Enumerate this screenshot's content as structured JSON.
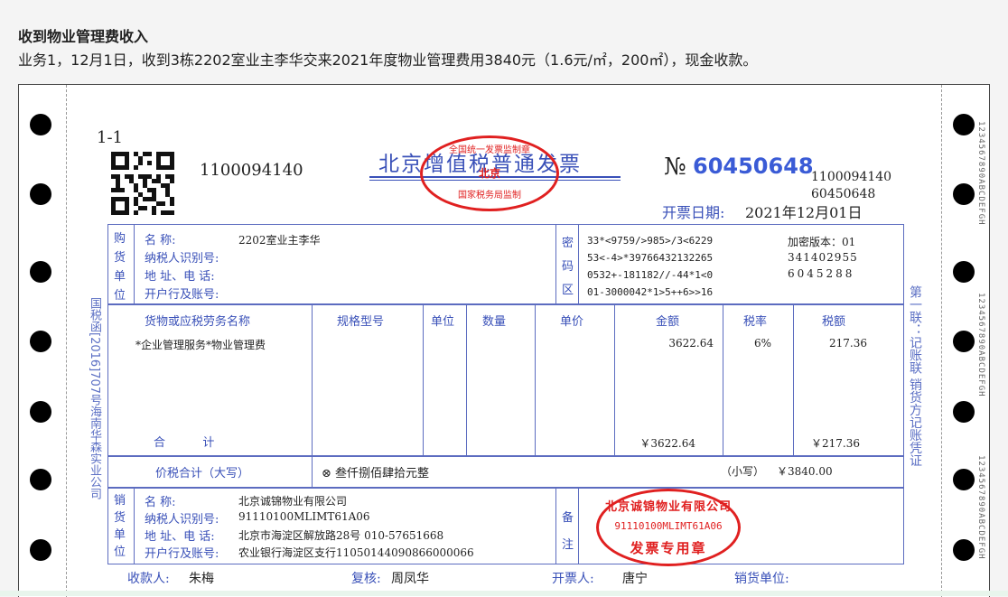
{
  "header": {
    "title": "收到物业管理费收入",
    "desc": "业务1，12月1日，收到3栋2202室业主李华交来2021年度物业管理费用3840元（1.6元/㎡，200㎡），现金收款。"
  },
  "invoice": {
    "copy_no": "1-1",
    "code": "1100094140",
    "title": "北京增值税普通发票",
    "no_prefix": "№",
    "number": "60450648",
    "code_right": "1100094140",
    "number_right": "60450648",
    "date_label": "开票日期:",
    "date": "2021年12月01日",
    "left_side_text": "国税函[2016]707号海南华森实业公司",
    "right_side_text": "第一联：记账联  销货方记账凭证",
    "stamp_tax": {
      "top": "全国统一发票监制章",
      "mid": "北京",
      "bottom": "国家税务局监制"
    },
    "buyer": {
      "section": "购货单位",
      "name_label": "名        称:",
      "name": "2202室业主李华",
      "tax_label": "纳税人识别号:",
      "addr_label": "地 址、电 话:",
      "bank_label": "开户行及账号:"
    },
    "cipher": {
      "label": "密码区",
      "lines": [
        "33*<9759/>985>/3<6229",
        "53<-4>*39766432132265",
        "0532+-181182//-44*1<0",
        "01-3000042*1>5++6>>16"
      ],
      "version_label": "加密版本：01",
      "v_line1": "341402955",
      "v_line2": "6045288"
    },
    "columns": {
      "item": "货物或应税劳务名称",
      "spec": "规格型号",
      "unit": "单位",
      "qty": "数量",
      "price": "单价",
      "amount": "金额",
      "rate": "税率",
      "tax": "税额"
    },
    "item": {
      "name": "*企业管理服务*物业管理费",
      "amount": "3622.64",
      "rate": "6%",
      "tax": "217.36"
    },
    "total": {
      "label": "合          计",
      "amount": "￥3622.64",
      "tax": "￥217.36"
    },
    "grand": {
      "label": "价税合计（大写）",
      "words": "⊗ 叁仟捌佰肆拾元整",
      "small_label": "（小写）",
      "small": "￥3840.00"
    },
    "seller": {
      "section": "销货单位",
      "name_label": "名        称:",
      "name": "北京诚锦物业有限公司",
      "tax_label": "纳税人识别号:",
      "tax_id": "91110100MLIMT61A06",
      "addr_label": "地 址、电 话:",
      "addr": "北京市海淀区解放路28号 010-57651668",
      "bank_label": "开户行及账号:",
      "bank": "农业银行海淀区支行11050144090866000066"
    },
    "remark_label": "备注",
    "stamp_company": {
      "name": "北京诚锦物业有限公司",
      "id": "91110100MLIMT61A06",
      "sub": "发票专用章"
    },
    "footer": {
      "payee_label": "收款人:",
      "payee": "朱梅",
      "reviewer_label": "复核:",
      "reviewer": "周凤华",
      "drawer_label": "开票人:",
      "drawer": "唐宁",
      "seller_label": "销货单位:"
    },
    "strip_code": "1234567890ABCDEFGH"
  },
  "colors": {
    "blue": "#3950b8",
    "red": "#e02020",
    "line": "#5c6cc0"
  }
}
